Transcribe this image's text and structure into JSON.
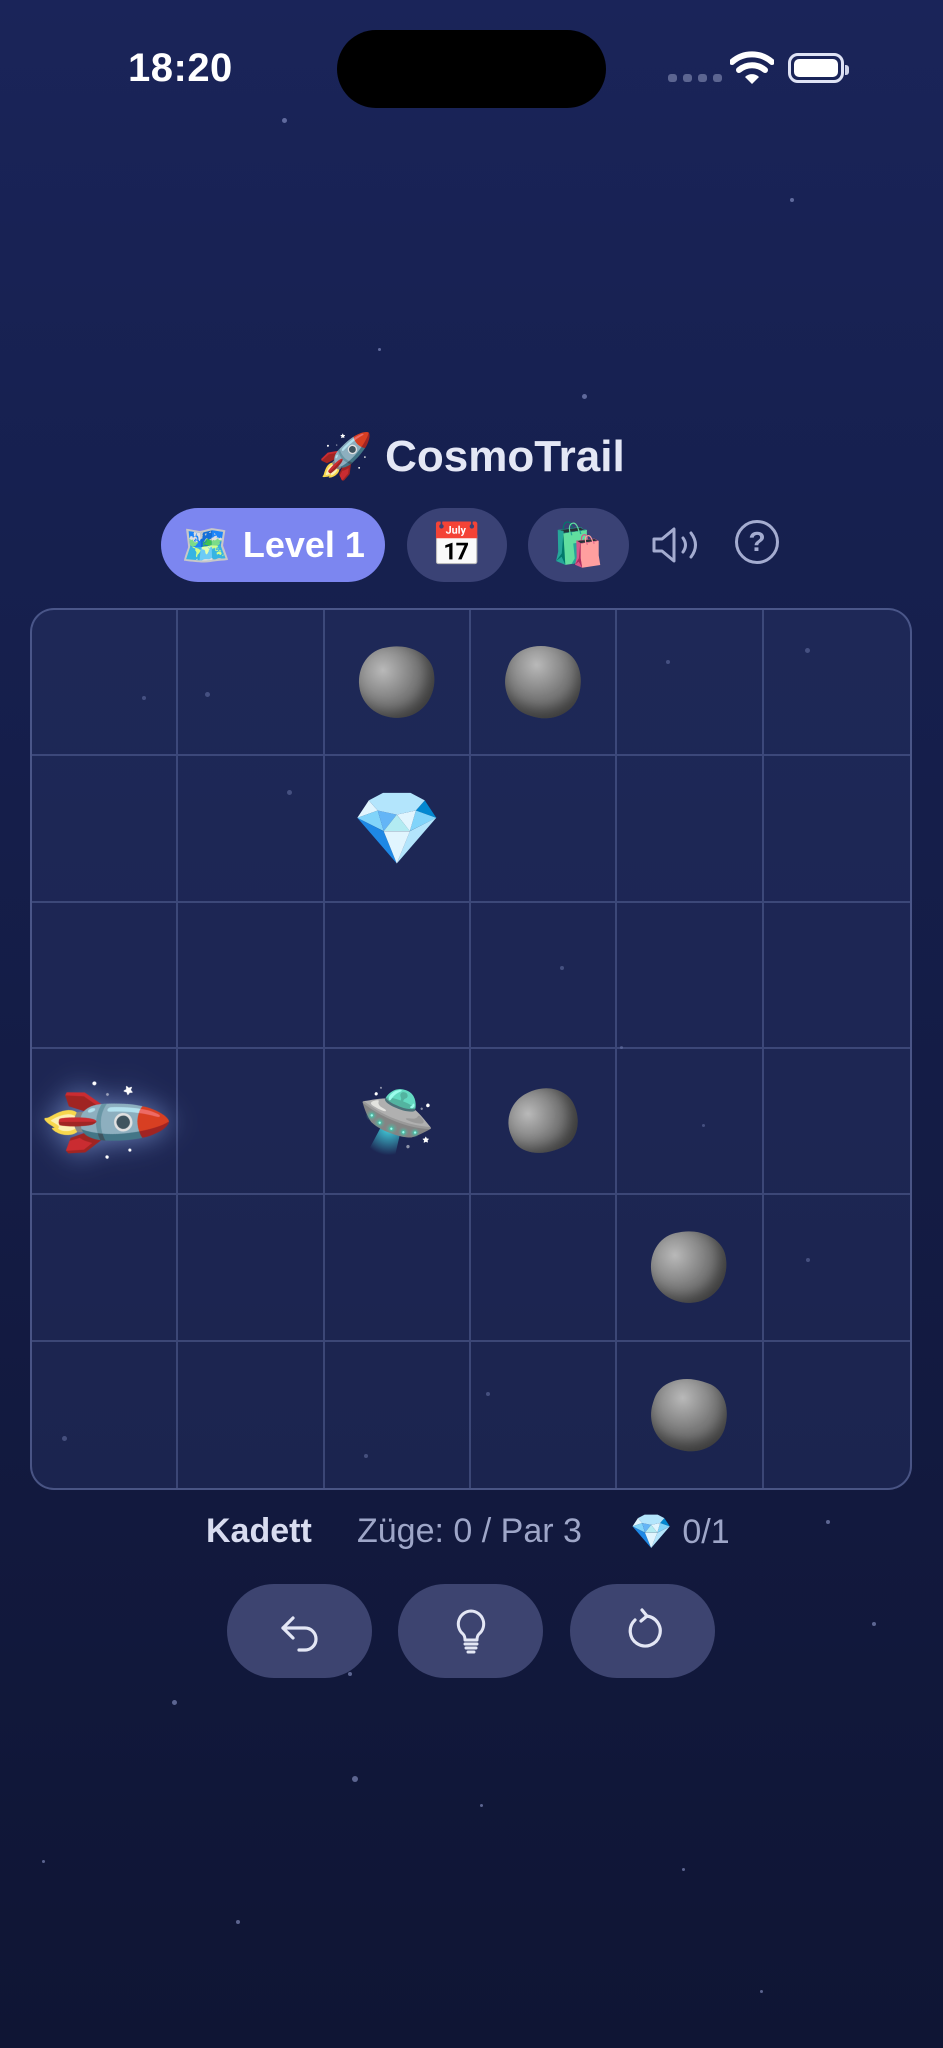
{
  "status": {
    "time": "18:20"
  },
  "header": {
    "title": "CosmoTrail",
    "title_icon": "🚀"
  },
  "toolbar": {
    "level_icon": "🗺️",
    "level_label": "Level 1",
    "calendar_icon": "📅",
    "shop_icon": "🛍️",
    "sound_icon": "speaker-icon",
    "help_label": "?"
  },
  "board": {
    "rows": 6,
    "cols": 6,
    "cells": [
      [
        "",
        "",
        "asteroid",
        "asteroid",
        "",
        ""
      ],
      [
        "",
        "",
        "gem",
        "",
        "",
        ""
      ],
      [
        "",
        "",
        "",
        "",
        "",
        ""
      ],
      [
        "rocket",
        "",
        "ufo",
        "asteroid",
        "",
        ""
      ],
      [
        "",
        "",
        "",
        "",
        "asteroid",
        ""
      ],
      [
        "",
        "",
        "",
        "",
        "asteroid",
        ""
      ]
    ],
    "glyphs": {
      "rocket": "🚀",
      "ufo": "🛸",
      "gem": "💎"
    }
  },
  "stats": {
    "rank": "Kadett",
    "moves": "Züge: 0 / Par 3",
    "gem_icon": "💎",
    "gems": "0/1"
  },
  "actions": [
    {
      "name": "undo-button",
      "icon": "undo-icon"
    },
    {
      "name": "hint-button",
      "icon": "lightbulb-icon"
    },
    {
      "name": "restart-button",
      "icon": "restart-icon"
    }
  ],
  "colors": {
    "accent": "#7c86f0",
    "button_bg": "#3d4470",
    "background_top": "#1a2459",
    "background_bottom": "#0f1534"
  }
}
